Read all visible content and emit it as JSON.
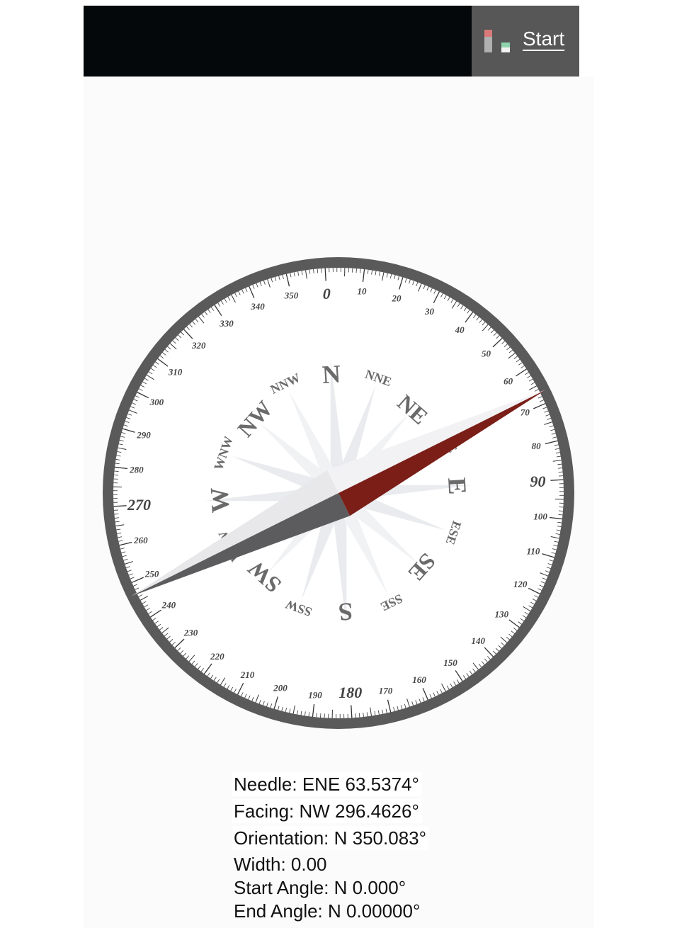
{
  "header": {
    "start_label": "Start",
    "status_icon": "level-meter-icon",
    "colors": {
      "bar_background": "#05080a",
      "start_area_background": "#575757",
      "indicator_red": "#d77a78",
      "indicator_gray": "#b0b0b0",
      "indicator_green": "#8fd3ae"
    }
  },
  "compass": {
    "degree_labels": [
      "0",
      "10",
      "20",
      "30",
      "40",
      "50",
      "60",
      "70",
      "80",
      "90",
      "100",
      "110",
      "120",
      "130",
      "140",
      "150",
      "160",
      "170",
      "180",
      "190",
      "200",
      "210",
      "220",
      "230",
      "240",
      "250",
      "260",
      "270",
      "280",
      "290",
      "300",
      "310",
      "320",
      "330",
      "340",
      "350"
    ],
    "direction_labels": [
      "N",
      "NNE",
      "NE",
      "ENE",
      "E",
      "ESE",
      "SE",
      "SSE",
      "S",
      "SSW",
      "SW",
      "WSW",
      "W",
      "WNW",
      "NW",
      "NNW"
    ],
    "needle_bearing_deg": 63.5374,
    "dial_rotation_deg": -3.4,
    "colors": {
      "rim": "#5a5a5a",
      "face": "#ffffff",
      "rose": "#ececec",
      "needle_north": "#7a1e17",
      "needle_north_dark": "#6a1610",
      "needle_south_light": "#e8e8ea",
      "needle_south_dark": "#5c5c5e"
    }
  },
  "readouts": {
    "needle": "Needle: ENE 63.5374°",
    "facing": "Facing: NW 296.4626°",
    "orientation": "Orientation: N 350.083°",
    "width": "Width: 0.00",
    "start_angle": "Start Angle: N 0.000°",
    "end_angle": "End Angle: N 0.00000°"
  }
}
